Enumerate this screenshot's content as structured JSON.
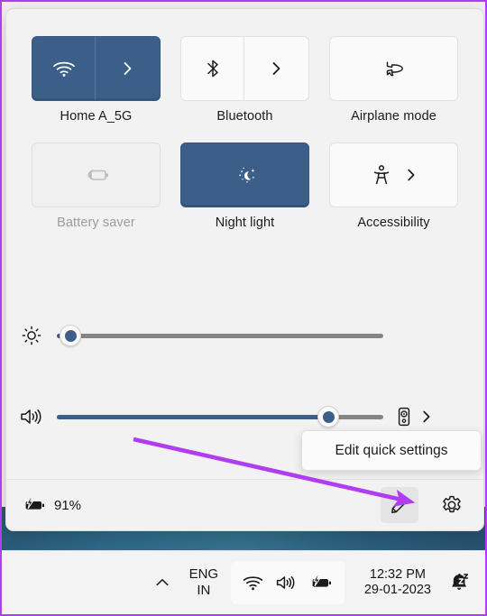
{
  "panel": {
    "tiles": [
      [
        {
          "label": "Home A_5G",
          "state": "on",
          "icon": "wifi-icon",
          "has_chevron": true,
          "split": true,
          "name": "wifi"
        },
        {
          "label": "Bluetooth",
          "state": "off",
          "icon": "bluetooth-icon",
          "has_chevron": true,
          "split": true,
          "name": "bluetooth"
        },
        {
          "label": "Airplane mode",
          "state": "off",
          "icon": "airplane-icon",
          "has_chevron": false,
          "split": false,
          "name": "airplane-mode"
        }
      ],
      [
        {
          "label": "Battery saver",
          "state": "disabled",
          "icon": "battery-saver-icon",
          "has_chevron": false,
          "split": false,
          "name": "battery-saver"
        },
        {
          "label": "Night light",
          "state": "on",
          "icon": "night-light-icon",
          "has_chevron": false,
          "split": false,
          "name": "night-light"
        },
        {
          "label": "Accessibility",
          "state": "off",
          "icon": "accessibility-icon",
          "has_chevron": true,
          "split": false,
          "name": "accessibility"
        }
      ]
    ],
    "brightness": {
      "icon": "brightness-icon",
      "value": 4,
      "min": 0,
      "max": 100
    },
    "volume": {
      "icon": "volume-icon",
      "value": 83,
      "min": 0,
      "max": 100,
      "output_icon": "speaker-device-icon",
      "output_chevron": "chevron-right-icon"
    },
    "footer": {
      "battery_icon": "battery-charging-icon",
      "battery_percent": "91%",
      "edit_icon": "pencil-icon",
      "settings_icon": "gear-icon"
    }
  },
  "tooltip": {
    "text": "Edit quick settings"
  },
  "taskbar": {
    "chevron_icon": "chevron-up-icon",
    "language_line1": "ENG",
    "language_line2": "IN",
    "tray": [
      {
        "name": "wifi-icon"
      },
      {
        "name": "volume-icon"
      },
      {
        "name": "battery-charging-icon"
      }
    ],
    "time": "12:32 PM",
    "date": "29-01-2023",
    "notification_icon": "bell-dnd-icon"
  },
  "colors": {
    "accent": "#3c5f8a",
    "annotation": "#b13df0",
    "panel_bg": "#f2f2f2",
    "tile_off": "#fafafa",
    "text": "#1b1b1b",
    "text_dim": "#9d9d9d"
  }
}
